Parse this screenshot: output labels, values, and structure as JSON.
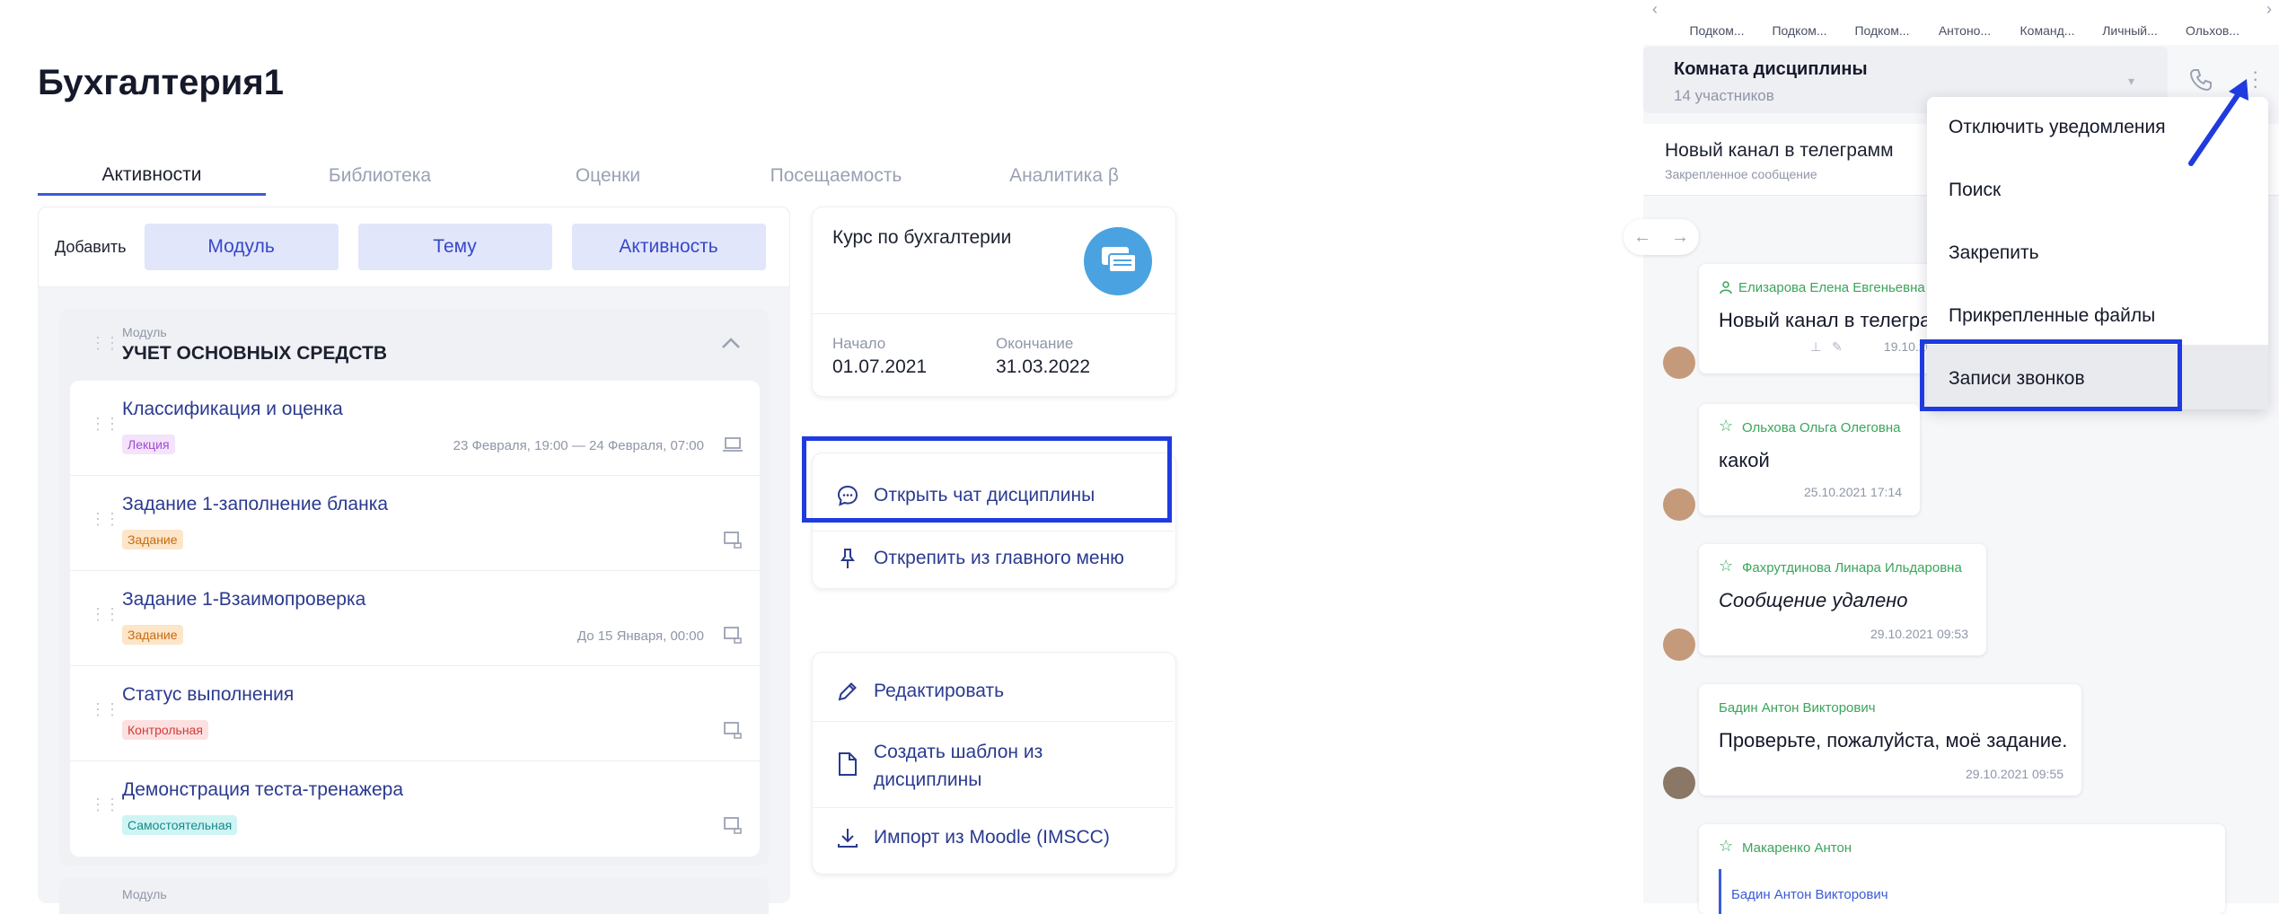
{
  "page": {
    "title": "Бухгалтерия1"
  },
  "tabs": [
    "Активности",
    "Библиотека",
    "Оценки",
    "Посещаемость",
    "Аналитика β"
  ],
  "add_bar": {
    "label": "Добавить",
    "buttons": [
      "Модуль",
      "Тему",
      "Активность"
    ]
  },
  "module": {
    "small_label": "Модуль",
    "name": "УЧЕТ ОСНОВНЫХ СРЕДСТВ",
    "items": [
      {
        "name": "Классификация и оценка",
        "badge": "Лекция",
        "date": "23 Февраля, 19:00 — 24 Февраля, 07:00"
      },
      {
        "name": "Задание 1-заполнение бланка",
        "badge": "Задание",
        "date": ""
      },
      {
        "name": "Задание 1-Взаимопроверка",
        "badge": "Задание",
        "date": "До 15 Января, 00:00"
      },
      {
        "name": "Статус выполнения",
        "badge": "Контрольная",
        "date": ""
      },
      {
        "name": "Демонстрация теста-тренажера",
        "badge": "Самостоятельная",
        "date": ""
      }
    ],
    "next_small_label": "Модуль"
  },
  "badge_colors": {
    "Лекция": {
      "bg": "#f3e3fb",
      "fg": "#a24bd1"
    },
    "Задание": {
      "bg": "#fde5c8",
      "fg": "#c76b12"
    },
    "Контрольная": {
      "bg": "#fde0e0",
      "fg": "#d23b3b"
    },
    "Самостоятельная": {
      "bg": "#cff4f4",
      "fg": "#178a8a"
    }
  },
  "course": {
    "name": "Курс по бухгалтерии",
    "start_label": "Начало",
    "start": "01.07.2021",
    "end_label": "Окончание",
    "end": "31.03.2022"
  },
  "actions_top": {
    "open_chat": "Открыть чат дисциплины",
    "unpin": "Открепить из главного меню"
  },
  "actions_bottom": {
    "edit": "Редактировать",
    "template_1": "Создать шаблон из",
    "template_2": "дисциплины",
    "import": "Импорт из Moodle (IMSCC)"
  },
  "chat": {
    "avatars": [
      "Подком...",
      "Подком...",
      "Подком...",
      "Антоно...",
      "Команд...",
      "Личный...",
      "Ольхов..."
    ],
    "room_title": "Комната дисциплины",
    "room_subtitle": "14 участников",
    "pinned_title": "Новый канал в телеграмм",
    "pinned_sub": "Закрепленное сообщение",
    "messages": [
      {
        "author": "Елизарова Елена Евгеньевна",
        "text": "Новый канал в телегра",
        "time": "19.10.2021"
      },
      {
        "author": "Ольхова Ольга Олеговна",
        "text": "какой",
        "time": "25.10.2021 17:14"
      },
      {
        "author": "Фахрутдинова Линара Ильдаровна",
        "text": "Сообщение удалено",
        "time": "29.10.2021 09:53"
      },
      {
        "author": "Бадин Антон Викторович",
        "text": "Проверьте, пожалуйста, моё задание.",
        "time": "29.10.2021 09:55"
      },
      {
        "author": "Макаренко Антон",
        "text": "",
        "time": ""
      },
      {
        "author": "Бадин Антон Викторович",
        "text": "",
        "time": ""
      }
    ],
    "menu": [
      "Отключить уведомления",
      "Поиск",
      "Закрепить",
      "Прикрепленные файлы",
      "Записи звонков"
    ]
  },
  "colors": {
    "accent": "#3b5bd6",
    "highlight": "#1f3be0",
    "link": "#2a3a8f"
  }
}
